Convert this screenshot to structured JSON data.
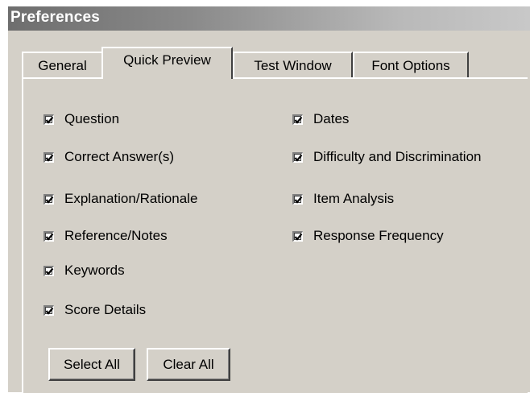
{
  "window": {
    "title": "Preferences"
  },
  "tabs": [
    {
      "label": "General",
      "active": false
    },
    {
      "label": "Quick Preview",
      "active": true
    },
    {
      "label": "Test Window",
      "active": false
    },
    {
      "label": "Font Options",
      "active": false
    }
  ],
  "options": {
    "left": [
      {
        "label": "Question",
        "checked": true
      },
      {
        "label": "Correct Answer(s)",
        "checked": true
      },
      {
        "label": "Explanation/Rationale",
        "checked": true
      },
      {
        "label": "Reference/Notes",
        "checked": true
      },
      {
        "label": "Keywords",
        "checked": true
      },
      {
        "label": "Score Details",
        "checked": true
      }
    ],
    "right": [
      {
        "label": "Dates",
        "checked": true
      },
      {
        "label": "Difficulty and Discrimination",
        "checked": true
      },
      {
        "label": "Item Analysis",
        "checked": true
      },
      {
        "label": "Response Frequency",
        "checked": true
      }
    ]
  },
  "buttons": {
    "select_all": "Select All",
    "clear_all": "Clear All"
  },
  "colors": {
    "dialog_face": "#d4d0c8",
    "titlebar_start": "#6e6e6e",
    "titlebar_end": "#c8c8c8",
    "highlight": "#ffffff",
    "shadow": "#404040"
  }
}
